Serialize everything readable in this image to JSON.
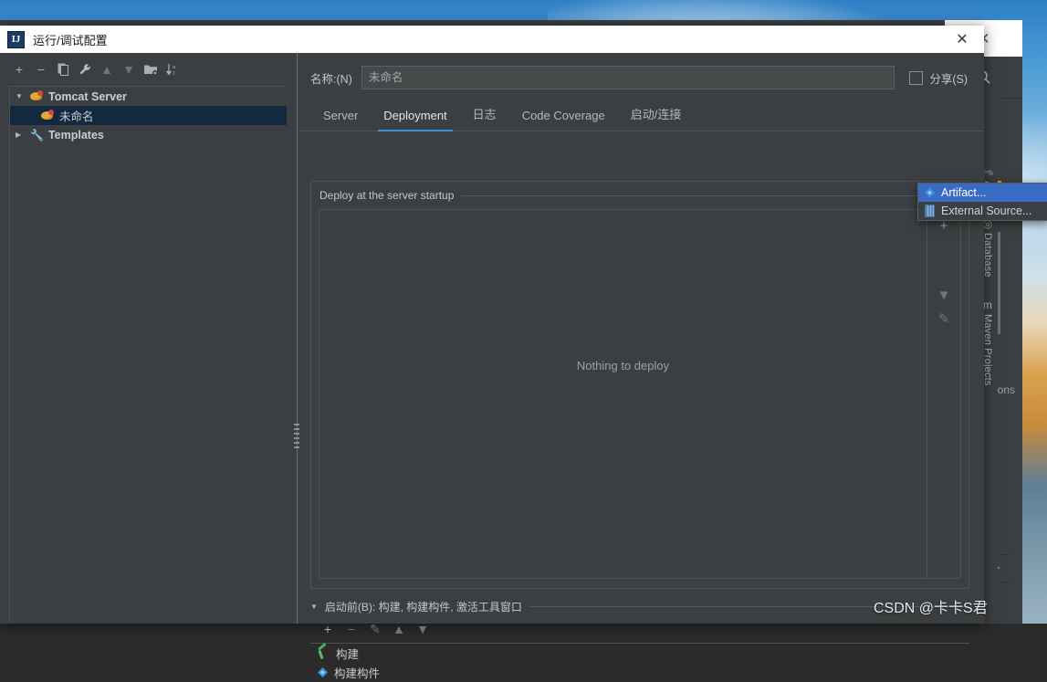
{
  "desktop": {
    "wallpaper": "sky-landscape"
  },
  "background_ide": {
    "close_label": "✕",
    "search_icon": "search-icon",
    "minus_label": "−",
    "response_text": "spons",
    "right_tabs": [
      {
        "label": "Ant",
        "icon": "ant-icon"
      },
      {
        "label": "Database",
        "icon": "database-icon"
      },
      {
        "label": "Maven Projects",
        "icon": "maven-icon"
      }
    ]
  },
  "dialog": {
    "icon_text": "IJ",
    "title": "运行/调试配置",
    "close_label": "✕",
    "toolbar": [
      {
        "name": "add-button",
        "glyph": "+"
      },
      {
        "name": "remove-button",
        "glyph": "−"
      },
      {
        "name": "copy-button",
        "glyph": "❐"
      },
      {
        "name": "edit-templates-button",
        "glyph": "🔧"
      },
      {
        "name": "move-up-button",
        "glyph": "▲"
      },
      {
        "name": "move-down-button",
        "glyph": "▼"
      },
      {
        "name": "new-folder-button",
        "glyph": "🗀"
      },
      {
        "name": "sort-button",
        "glyph": "↓"
      }
    ],
    "tree": [
      {
        "label": "Tomcat Server",
        "level": 1,
        "expanded": true,
        "icon": "tomcat-icon",
        "selected": false,
        "bold": true
      },
      {
        "label": "未命名",
        "level": 2,
        "expanded": null,
        "icon": "tomcat-icon",
        "selected": true,
        "bold": false
      },
      {
        "label": "Templates",
        "level": 1,
        "expanded": false,
        "icon": "wrench-icon",
        "selected": false,
        "bold": true
      }
    ],
    "name_label": "名称:(N)",
    "name_value": "未命名",
    "share_label": "分享(S)",
    "share_checked": false,
    "tabs": [
      {
        "label": "Server",
        "active": false
      },
      {
        "label": "Deployment",
        "active": true
      },
      {
        "label": "日志",
        "active": false
      },
      {
        "label": "Code Coverage",
        "active": false
      },
      {
        "label": "启动/连接",
        "active": false
      }
    ],
    "deployment": {
      "legend": "Deploy at the server startup",
      "empty_text": "Nothing to deploy",
      "side_buttons": [
        {
          "name": "add-artifact-button",
          "glyph": "+",
          "dim": false
        },
        {
          "name": "move-down-button",
          "glyph": "▼",
          "dim": true
        },
        {
          "name": "edit-button",
          "glyph": "✎",
          "dim": true
        }
      ]
    },
    "popup": {
      "items": [
        {
          "label": "Artifact...",
          "icon": "artifact-diamond-icon",
          "selected": true
        },
        {
          "label": "External Source...",
          "icon": "external-source-icon",
          "selected": false
        }
      ]
    },
    "before_launch": {
      "header": "启动前(B): 构建, 构建构件, 激活工具窗口",
      "toolbar": [
        {
          "name": "add-task-button",
          "glyph": "+",
          "dim": false
        },
        {
          "name": "remove-task-button",
          "glyph": "−",
          "dim": true
        },
        {
          "name": "edit-task-button",
          "glyph": "✎",
          "dim": true
        },
        {
          "name": "task-up-button",
          "glyph": "▲",
          "dim": true
        },
        {
          "name": "task-down-button",
          "glyph": "▼",
          "dim": true
        }
      ],
      "items": [
        {
          "label": "构建",
          "icon": "hammer-icon"
        },
        {
          "label": "构建构件",
          "icon": "artifact-diamond-icon"
        }
      ]
    }
  },
  "watermark": "CSDN @卡卡S君",
  "colors": {
    "accent_blue": "#3b8ee0",
    "selection_blue": "#3a6bc4",
    "tree_selection": "#13293f",
    "panel_bg": "#3c3f41",
    "editor_bg": "#2b2b2b"
  }
}
